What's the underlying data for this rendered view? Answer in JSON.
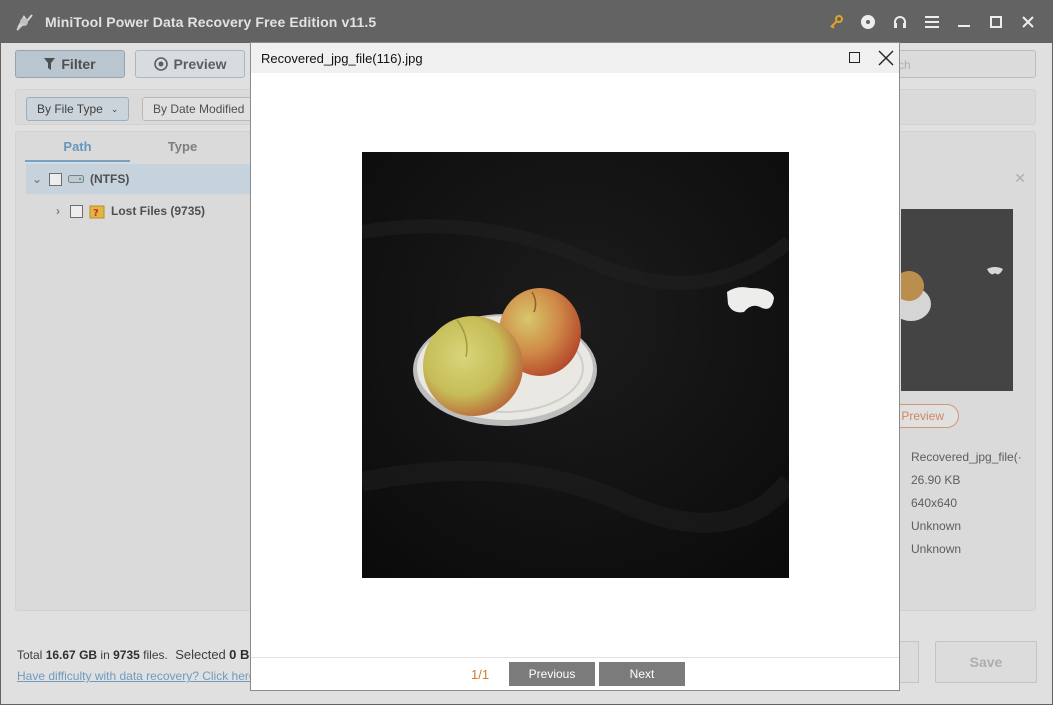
{
  "window": {
    "title": "MiniTool Power Data Recovery Free Edition v11.5",
    "titlebar_icons": [
      "key-icon",
      "disc-icon",
      "headset-icon",
      "menu-icon",
      "minimize-icon",
      "maximize-icon",
      "close-icon"
    ]
  },
  "toolbar": {
    "filter_label": "Filter",
    "preview_label": "Preview",
    "search_placeholder": "ch"
  },
  "filters": {
    "by_file_type": "By File Type",
    "by_date_modified": "By Date Modified"
  },
  "tree": {
    "tabs": [
      "Path",
      "Type"
    ],
    "items": [
      {
        "label": "(NTFS)"
      },
      {
        "label": "Lost Files (9735)"
      }
    ]
  },
  "details": {
    "preview_label": "Preview",
    "file_name": "Recovered_jpg_file(·",
    "size": "26.90 KB",
    "dimensions": "640x640",
    "date_created": "Unknown",
    "date_modified": "Unknown"
  },
  "status": {
    "total_label": "Total",
    "total_size": "16.67 GB",
    "in_label": "in",
    "file_count": "9735",
    "files_label": "files.",
    "selected_label": "Selected",
    "selected_value": "0 B",
    "help_link": "Have difficulty with data recovery? Click here"
  },
  "save_label": "Save",
  "preview_dialog": {
    "title": "Recovered_jpg_file(116).jpg",
    "pager": "1/1",
    "previous_label": "Previous",
    "next_label": "Next"
  },
  "colors": {
    "titlebar": "#6b6b6b",
    "accent_blue": "#6fa2c9",
    "pager_orange": "#d47a2c",
    "nav_button": "#7b7b7b"
  }
}
